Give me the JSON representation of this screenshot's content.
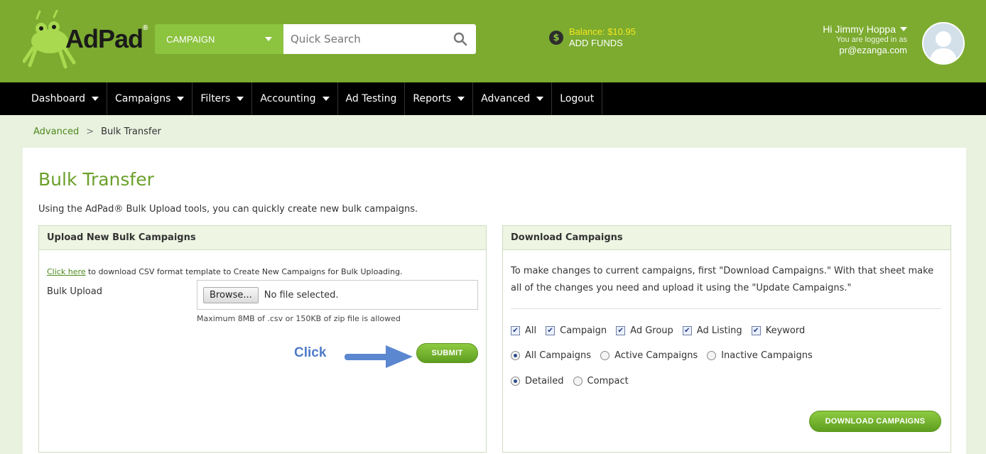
{
  "header": {
    "logo_text": "AdPad",
    "logo_mark": "®",
    "search": {
      "category": "CAMPAIGN",
      "placeholder": "Quick Search"
    },
    "balance": {
      "amount_label": "Balance: $10.95",
      "add_funds": "ADD FUNDS"
    },
    "user": {
      "greeting": "Hi Jimmy Hoppa",
      "logged_in_as": "You are logged in as",
      "email": "pr@ezanga.com"
    }
  },
  "nav": {
    "items": [
      {
        "label": "Dashboard",
        "has_menu": true
      },
      {
        "label": "Campaigns",
        "has_menu": true
      },
      {
        "label": "Filters",
        "has_menu": true
      },
      {
        "label": "Accounting",
        "has_menu": true
      },
      {
        "label": "Ad Testing",
        "has_menu": false
      },
      {
        "label": "Reports",
        "has_menu": true
      },
      {
        "label": "Advanced",
        "has_menu": true
      },
      {
        "label": "Logout",
        "has_menu": false
      }
    ]
  },
  "breadcrumb": {
    "parent": "Advanced",
    "separator": ">",
    "current": "Bulk Transfer"
  },
  "page": {
    "title": "Bulk Transfer",
    "description": "Using the AdPad® Bulk Upload tools, you can quickly create new bulk campaigns."
  },
  "upload": {
    "heading": "Upload New Bulk Campaigns",
    "template_link": "Click here",
    "template_text": " to download CSV format template to Create New Campaigns for Bulk Uploading.",
    "field_label": "Bulk Upload",
    "browse_label": "Browse...",
    "file_status": "No file selected.",
    "note": "Maximum 8MB of .csv or 150KB of zip file is allowed",
    "annotation": "Click",
    "submit_label": "SUBMIT"
  },
  "download": {
    "heading": "Download Campaigns",
    "instructions": "To make changes to current campaigns, first \"Download Campaigns.\" With that sheet make all of the changes you need and upload it using the \"Update Campaigns.\"",
    "checkboxes": [
      {
        "label": "All",
        "checked": true
      },
      {
        "label": "Campaign",
        "checked": true
      },
      {
        "label": "Ad Group",
        "checked": true
      },
      {
        "label": "Ad Listing",
        "checked": true
      },
      {
        "label": "Keyword",
        "checked": true
      }
    ],
    "scope_radios": [
      {
        "label": "All Campaigns",
        "selected": true
      },
      {
        "label": "Active Campaigns",
        "selected": false
      },
      {
        "label": "Inactive Campaigns",
        "selected": false
      }
    ],
    "format_radios": [
      {
        "label": "Detailed",
        "selected": true
      },
      {
        "label": "Compact",
        "selected": false
      }
    ],
    "button_label": "DOWNLOAD CAMPAIGNS"
  },
  "colors": {
    "header_green": "#7cab30",
    "accent_green": "#8cc33f",
    "title_green": "#6aa02a",
    "balance_yellow": "#f6e71d",
    "annotation_blue": "#4f7ac9"
  }
}
